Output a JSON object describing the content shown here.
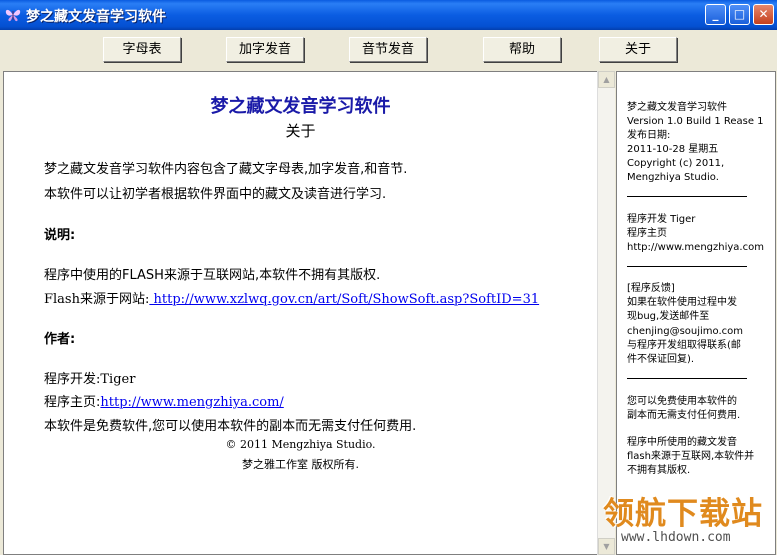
{
  "window": {
    "title": "梦之藏文发音学习软件",
    "controls": {
      "minimize": "_",
      "maximize": "□",
      "close": "✕"
    }
  },
  "toolbar": {
    "buttons": [
      "字母表",
      "加字发音",
      "音节发音",
      "帮助",
      "关于"
    ]
  },
  "content": {
    "title": "梦之藏文发音学习软件",
    "subtitle": "关于",
    "intro_1": "梦之藏文发音学习软件内容包含了藏文字母表,加字发音,和音节.",
    "intro_2": "本软件可以让初学者根据软件界面中的藏文及读音进行学习.",
    "section_note": "说明:",
    "note_1": "程序中使用的FLASH来源于互联网站,本软件不拥有其版权.",
    "flash_prefix": "Flash来源于网站:",
    "flash_url": " http://www.xzlwq.gov.cn/art/Soft/ShowSoft.asp?SoftID=31",
    "section_author": "作者:",
    "developer": "程序开发:Tiger",
    "homepage_prefix": "程序主页:",
    "homepage_url": "http://www.mengzhiya.com/",
    "free_note": "本软件是免费软件,您可以使用本软件的副本而无需支付任何费用.",
    "copyright_1": "© 2011 Mengzhiya Studio.",
    "copyright_2": "梦之雅工作室 版权所有."
  },
  "side_panel": {
    "app_name": "梦之藏文发音学习软件",
    "version": "Version 1.0 Build 1 Rease 1",
    "release_label": "发布日期:",
    "release_date": "2011-10-28 星期五",
    "copyright_1": "Copyright (c) 2011,",
    "copyright_2": "Mengzhiya Studio.",
    "dev_label": "程序开发  Tiger",
    "home_label": "程序主页",
    "home_url": "http://www.mengzhiya.com",
    "feedback_title": "[程序反馈]",
    "feedback_1": " 如果在软件使用过程中发",
    "feedback_2": "现bug,发送邮件至",
    "feedback_email": " chenjing@soujimo.com",
    "feedback_3": " 与程序开发组取得联系(邮",
    "feedback_4": "件不保证回复).",
    "free_1": " 您可以免费使用本软件的",
    "free_2": "副本而无需支付任何费用.",
    "flash_1": " 程序中所使用的藏文发音",
    "flash_2": "flash来源于互联网,本软件并",
    "flash_3": "不拥有其版权."
  },
  "watermark": {
    "text": "领航下载站",
    "url": "www.lhdown.com"
  }
}
